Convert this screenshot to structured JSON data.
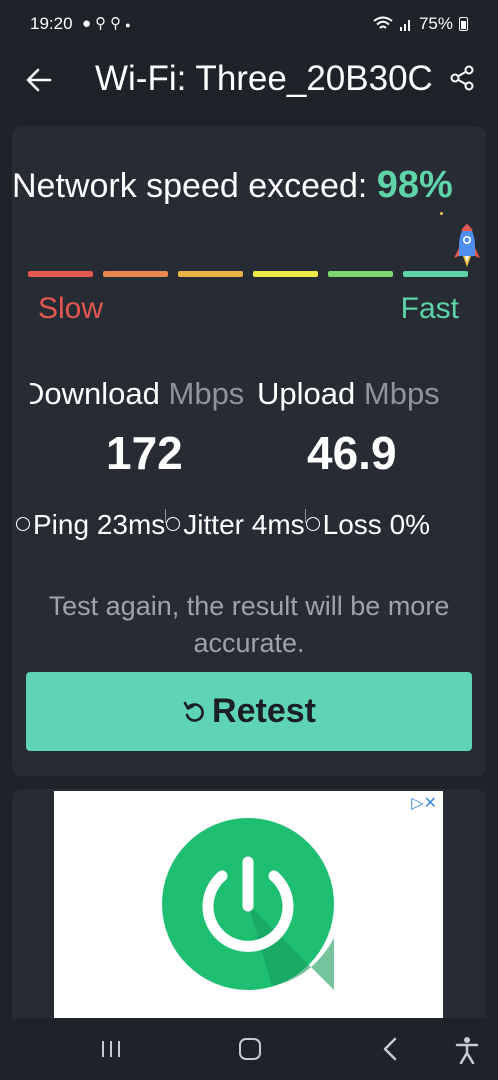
{
  "status_bar": {
    "time": "19:20",
    "left_icons": [
      "chat-icon",
      "location-icon",
      "location-icon",
      "dot-icon"
    ],
    "battery_percent": "75%",
    "right_icons": [
      "wifi-icon",
      "signal-icon",
      "battery-icon"
    ]
  },
  "app_bar": {
    "title": "Wi-Fi: Three_20B30C",
    "back_icon": "back-arrow-icon",
    "share_icon": "share-icon"
  },
  "speed_test": {
    "headline_label": "Network speed exceed:",
    "headline_percent": "98%",
    "meter": {
      "level": 0.98,
      "segment_colors": [
        "#e4574f",
        "#e8874d",
        "#ebb447",
        "#f0ea4a",
        "#7ed66e",
        "#5fd4a9"
      ],
      "slow_label": "Slow",
      "fast_label": "Fast"
    },
    "download": {
      "label": "Download",
      "unit": "Mbps",
      "value": "172"
    },
    "upload": {
      "label": "Upload",
      "unit": "Mbps",
      "value": "46.9"
    },
    "ping": "Ping 23ms",
    "jitter": "Jitter 4ms",
    "loss": "Loss 0%",
    "hint": "Test again, the result will be more accurate.",
    "retest_label": "Retest"
  },
  "ad": {
    "ad_choices": "▷✕",
    "image_icon": "power-button-icon"
  },
  "colors": {
    "background": "#1e2229",
    "card": "#262b34",
    "accent": "#5fd4b4",
    "slow": "#e4574f"
  }
}
